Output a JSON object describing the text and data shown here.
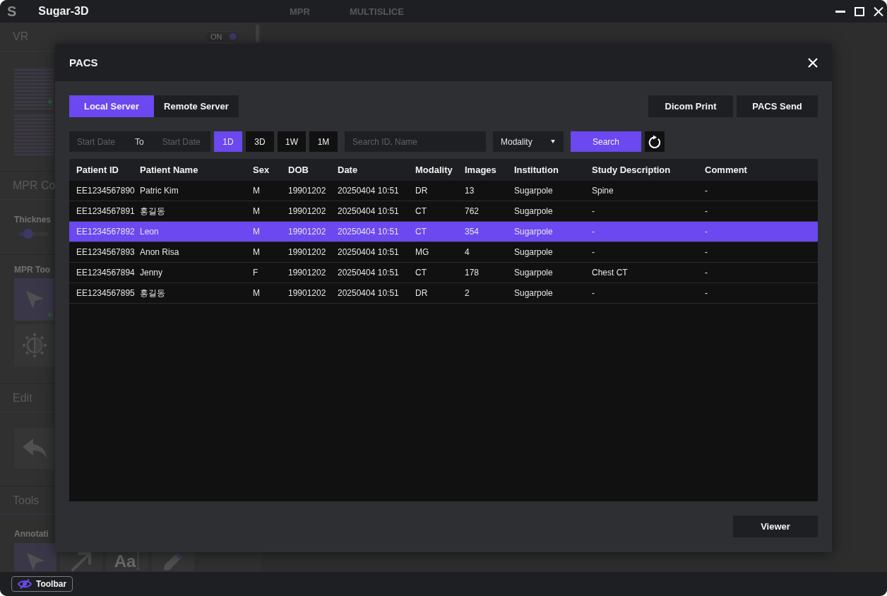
{
  "title_bar": {
    "logo": "S",
    "title": "Sugar-3D",
    "tabs": [
      {
        "label": "MPR",
        "selected": false
      },
      {
        "label": "MULTISLICE",
        "selected": false
      }
    ]
  },
  "sidebar": {
    "vr": {
      "title": "VR",
      "toggle": {
        "label": "ON",
        "on": true
      }
    },
    "mpr_controls": {
      "title": "MPR Co",
      "thickness": {
        "label": "Thicknes",
        "level": 0.3
      },
      "tools_label": "MPR Too",
      "tools": [
        {
          "kind": "pointer",
          "selected": true
        },
        {
          "kind": "contrast",
          "selected": false
        }
      ]
    },
    "edit": {
      "title": "Edit",
      "tools": [
        {
          "kind": "undo",
          "selected": false
        }
      ]
    },
    "tools": {
      "title": "Tools",
      "annotation_label": "Annotati",
      "tools": [
        {
          "kind": "pointer",
          "selected": true
        },
        {
          "kind": "arrow",
          "selected": false
        },
        {
          "kind": "text",
          "label": "Aa",
          "selected": false
        },
        {
          "kind": "pencil",
          "selected": false
        }
      ]
    }
  },
  "dialog": {
    "title": "PACS",
    "server_tabs": [
      {
        "label": "Local Server",
        "selected": true
      },
      {
        "label": "Remote Server",
        "selected": false
      }
    ],
    "actions": [
      "Dicom Print",
      "PACS Send"
    ],
    "filters": {
      "start_date": {
        "placeholder": "Start Date"
      },
      "to_label": "To",
      "end_date": {
        "placeholder": "Start Date"
      },
      "ranges": [
        {
          "label": "1D",
          "selected": true
        },
        {
          "label": "3D",
          "selected": false
        },
        {
          "label": "1W",
          "selected": false
        },
        {
          "label": "1M",
          "selected": false
        }
      ],
      "search_field": {
        "placeholder": "Search ID, Name"
      },
      "modality": {
        "value": "Modality"
      },
      "search_button": "Search"
    },
    "table": {
      "columns": [
        "Patient ID",
        "Patient Name",
        "Sex",
        "DOB",
        "Date",
        "Modality",
        "Images",
        "Institution",
        "Study Description",
        "Comment"
      ],
      "rows": [
        {
          "cells": [
            "EE1234567890",
            "Patric Kim",
            "M",
            "19901202",
            "20250404 10:51",
            "DR",
            "13",
            "Sugarpole",
            "Spine",
            "-"
          ],
          "selected": false
        },
        {
          "cells": [
            "EE1234567891",
            "홍길동",
            "M",
            "19901202",
            "20250404 10:51",
            "CT",
            "762",
            "Sugarpole",
            "-",
            "-"
          ],
          "selected": false
        },
        {
          "cells": [
            "EE1234567892",
            "Leon",
            "M",
            "19901202",
            "20250404 10:51",
            "CT",
            "354",
            "Sugarpole",
            "-",
            "-"
          ],
          "selected": true
        },
        {
          "cells": [
            "EE1234567893",
            "Anon Risa",
            "M",
            "19901202",
            "20250404 10:51",
            "MG",
            "4",
            "Sugarpole",
            "-",
            "-"
          ],
          "selected": false
        },
        {
          "cells": [
            "EE1234567894",
            "Jenny",
            "F",
            "19901202",
            "20250404 10:51",
            "CT",
            "178",
            "Sugarpole",
            "Chest CT",
            "-"
          ],
          "selected": false
        },
        {
          "cells": [
            "EE1234567895",
            "홍길동",
            "M",
            "19901202",
            "20250404 10:51",
            "DR",
            "2",
            "Sugarpole",
            "-",
            "-"
          ],
          "selected": false
        }
      ]
    },
    "footer_button": "Viewer"
  },
  "bottom_bar": {
    "toolbar_button": {
      "label": "Toolbar"
    }
  }
}
